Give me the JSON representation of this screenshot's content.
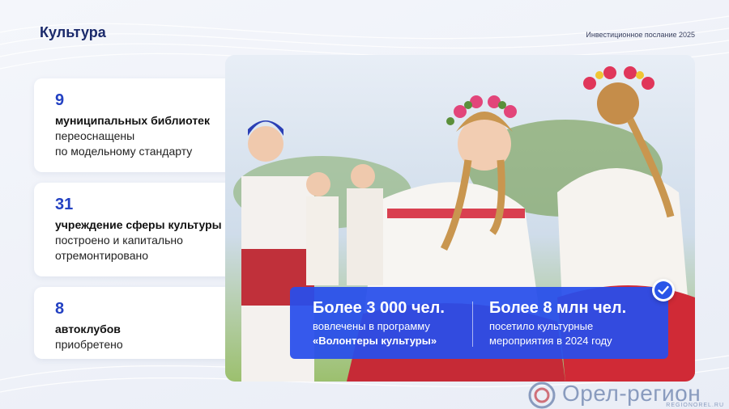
{
  "header": {
    "title": "Культура",
    "subtitle": "Инвестиционное послание 2025"
  },
  "cards": [
    {
      "number": "9",
      "bold": "муниципальных библиотек",
      "desc": "переоснащены\nпо модельному стандарту"
    },
    {
      "number": "31",
      "bold": "учреждение сферы культуры",
      "desc": "построено и капитально\nотремонтировано"
    },
    {
      "number": "8",
      "bold": "автоклубов",
      "desc": "приобретено"
    }
  ],
  "stats": [
    {
      "big": "Более 3 000 чел.",
      "line1": "вовлечены в программу",
      "line2": "«Волонтеры культуры»"
    },
    {
      "big": "Более 8 млн чел.",
      "line1": "посетило культурные",
      "line2": "мероприятия в 2024 году"
    }
  ],
  "watermark": {
    "text": "Орел-регион",
    "sub": "REGIONOREL.RU"
  },
  "colors": {
    "accent": "#2341c2",
    "stats_panel": "#274eec"
  },
  "icons": [
    "diamond-marker-icon",
    "check-icon",
    "watermark-logo-icon"
  ]
}
